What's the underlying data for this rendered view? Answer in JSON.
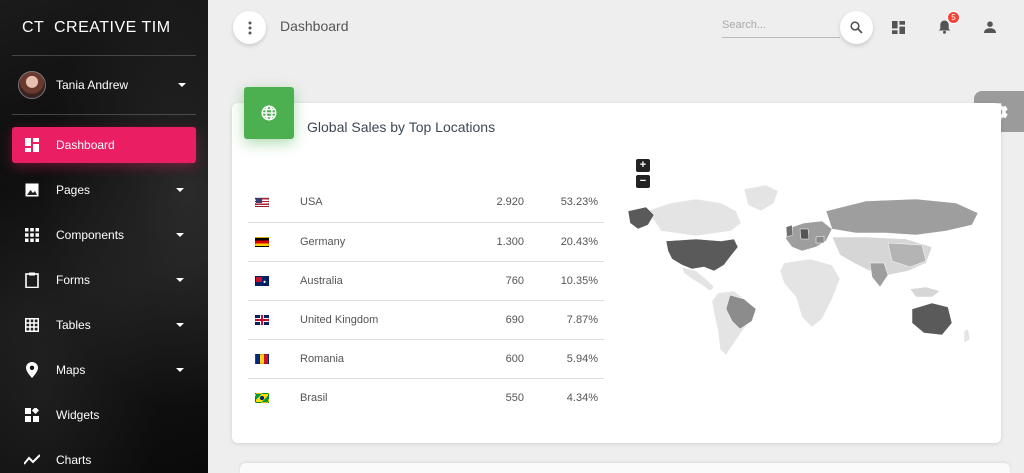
{
  "brand": {
    "mini": "CT",
    "name": "CREATIVE TIM"
  },
  "user": {
    "name": "Tania Andrew"
  },
  "nav": [
    {
      "label": "Dashboard",
      "icon": "dashboard-icon",
      "active": true
    },
    {
      "label": "Pages",
      "icon": "image-icon"
    },
    {
      "label": "Components",
      "icon": "apps-icon"
    },
    {
      "label": "Forms",
      "icon": "clipboard-icon"
    },
    {
      "label": "Tables",
      "icon": "grid-icon"
    },
    {
      "label": "Maps",
      "icon": "place-icon"
    },
    {
      "label": "Widgets",
      "icon": "widgets-icon"
    },
    {
      "label": "Charts",
      "icon": "timeline-icon"
    }
  ],
  "topbar": {
    "page_title": "Dashboard",
    "search_placeholder": "Search...",
    "notifications_count": "5"
  },
  "card": {
    "title": "Global Sales by Top Locations",
    "rows": [
      {
        "country": "USA",
        "sales": "2.920",
        "percent": "53.23%"
      },
      {
        "country": "Germany",
        "sales": "1.300",
        "percent": "20.43%"
      },
      {
        "country": "Australia",
        "sales": "760",
        "percent": "10.35%"
      },
      {
        "country": "United Kingdom",
        "sales": "690",
        "percent": "7.87%"
      },
      {
        "country": "Romania",
        "sales": "600",
        "percent": "5.94%"
      },
      {
        "country": "Brasil",
        "sales": "550",
        "percent": "4.34%"
      }
    ],
    "zoom_in": "+",
    "zoom_out": "−"
  },
  "colors": {
    "accent": "#e91e63",
    "card_header": "#4caf50",
    "map_dark": "#5a5a5a",
    "map_mid": "#9e9e9e",
    "map_light": "#e4e4e4"
  }
}
